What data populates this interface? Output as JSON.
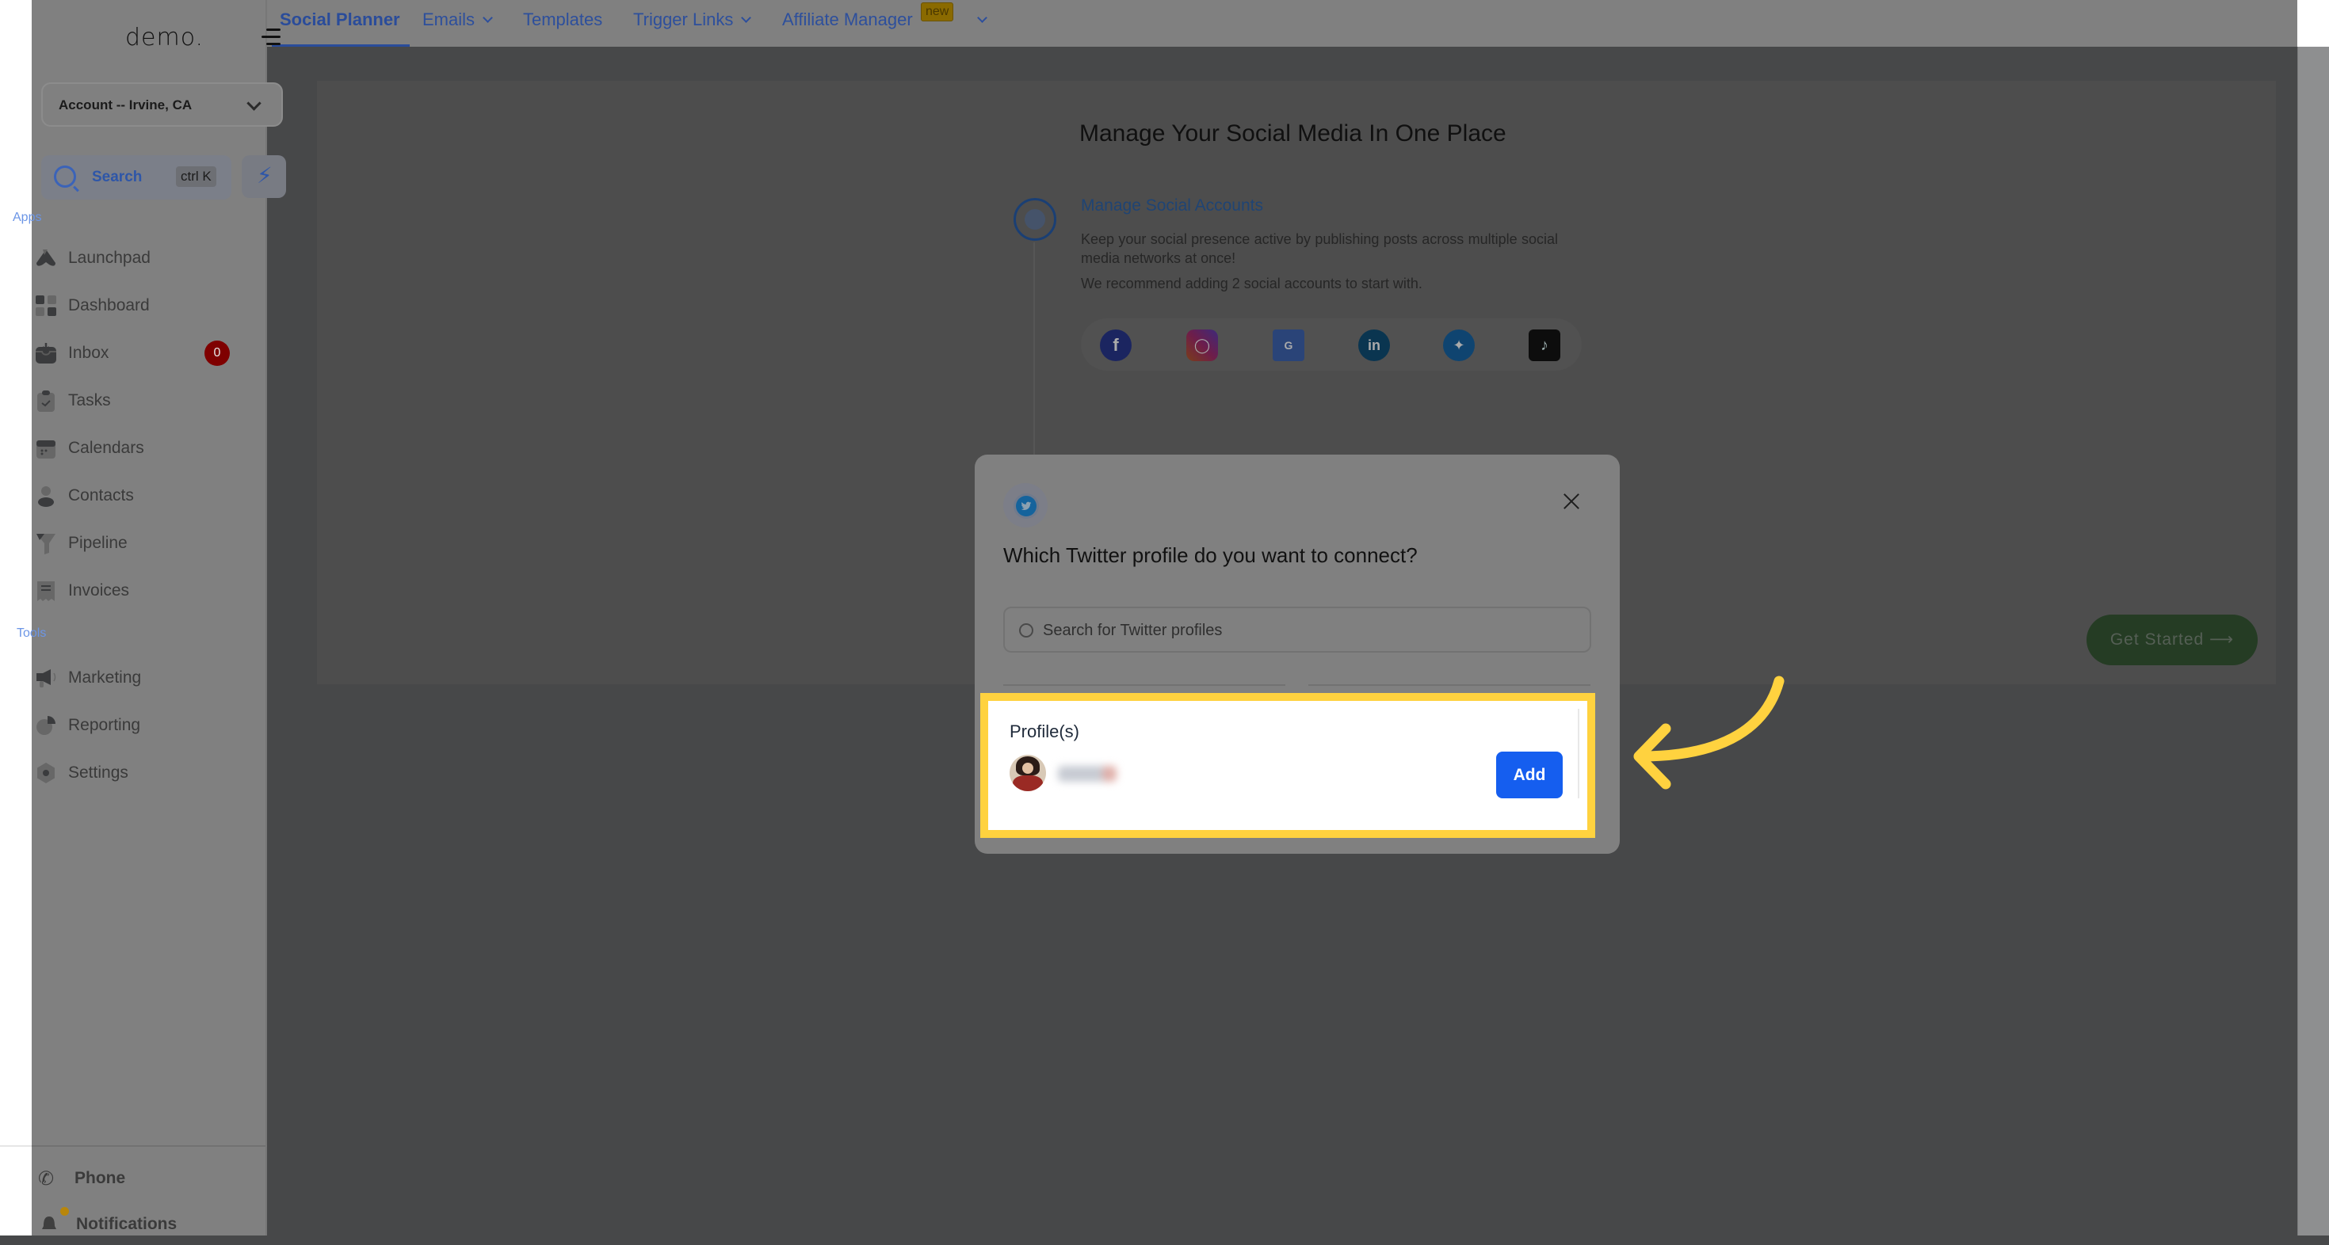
{
  "sidebar": {
    "logo": "demo.",
    "account": "Account -- Irvine, CA",
    "search_label": "Search",
    "search_shortcut": "ctrl K",
    "apps_heading": "Apps",
    "tools_heading": "Tools",
    "apps": [
      {
        "label": "Launchpad",
        "icon": "rocket-icon"
      },
      {
        "label": "Dashboard",
        "icon": "grid-icon"
      },
      {
        "label": "Inbox",
        "icon": "inbox-icon",
        "badge": "0"
      },
      {
        "label": "Tasks",
        "icon": "clipboard-check-icon"
      },
      {
        "label": "Calendars",
        "icon": "calendar-icon"
      },
      {
        "label": "Contacts",
        "icon": "user-icon"
      },
      {
        "label": "Pipeline",
        "icon": "funnel-icon"
      },
      {
        "label": "Invoices",
        "icon": "receipt-icon"
      }
    ],
    "tools": [
      {
        "label": "Marketing",
        "icon": "megaphone-icon"
      },
      {
        "label": "Reporting",
        "icon": "pie-chart-icon"
      },
      {
        "label": "Settings",
        "icon": "gear-icon"
      }
    ],
    "bottom": [
      {
        "label": "Phone",
        "icon": "phone-icon"
      },
      {
        "label": "Notifications",
        "icon": "bell-icon"
      }
    ]
  },
  "topnav": {
    "tabs": [
      {
        "label": "Social Planner",
        "active": true
      },
      {
        "label": "Emails",
        "dropdown": true
      },
      {
        "label": "Templates"
      },
      {
        "label": "Trigger Links",
        "dropdown": true
      },
      {
        "label": "Affiliate Manager",
        "badge": "new"
      }
    ]
  },
  "main": {
    "title": "Manage Your Social Media In One Place",
    "step_title": "Manage Social Accounts",
    "step_description": "Keep your social presence active by publishing posts across multiple social media networks at once!",
    "step_recommendation": "We recommend adding 2 social accounts to start with.",
    "networks": [
      "Facebook",
      "Instagram",
      "Google Business Profile",
      "LinkedIn",
      "Twitter",
      "TikTok"
    ],
    "cta": "Get Started ⟶"
  },
  "modal": {
    "title": "Which Twitter profile do you want to connect?",
    "search_placeholder": "Search for Twitter profiles",
    "search_value": "",
    "profiles_heading": "Profile(s)",
    "profiles": [
      {
        "name": "(blurred)",
        "action": "Add"
      }
    ]
  },
  "colors": {
    "highlight": "#ffd23f",
    "add_button": "#155eef",
    "inbox_badge": "#7f0000"
  }
}
